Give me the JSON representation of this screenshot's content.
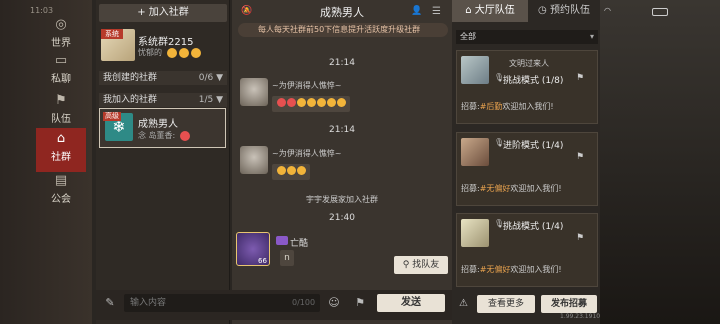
{
  "status_bar": {
    "clock": "11:03"
  },
  "nav": {
    "tabs": [
      {
        "label": "世界",
        "icon": "globe-icon",
        "active": false
      },
      {
        "label": "私聊",
        "icon": "chat-icon",
        "active": false
      },
      {
        "label": "队伍",
        "icon": "flag-icon",
        "active": false
      },
      {
        "label": "社群",
        "icon": "community-icon",
        "active": true
      },
      {
        "label": "公会",
        "icon": "guild-icon",
        "active": false
      }
    ]
  },
  "groups": {
    "join_label": "加入社群",
    "system": {
      "tag": "系统",
      "name": "系统群2215",
      "last_msg": "忧郁的"
    },
    "created": {
      "title": "我创建的社群",
      "count": "0/6"
    },
    "joined": {
      "title": "我加入的社群",
      "count": "1/5"
    },
    "selected": {
      "tag": "高级",
      "name": "成熟男人",
      "last_msg": "念 岛董香:"
    }
  },
  "chat": {
    "title": "成熟男人",
    "notice": "每人每天社群前50下信息提升活跃度升级社群",
    "messages": [
      {
        "time": "21:14",
        "name": "~为伊消得人憔悴~",
        "emoji_count": 7
      },
      {
        "time": "21:14",
        "name": "~为伊消得人憔悴~",
        "emoji_count": 3
      }
    ],
    "system_note": "宇宇发展家加入社群",
    "last_time": "21:40",
    "last_sender": {
      "name": "亡酷",
      "level": "66",
      "text": "n"
    },
    "find_team_label": "找队友",
    "input_placeholder": "输入内容",
    "input_counter": "0/100",
    "send_label": "发送"
  },
  "team": {
    "tab_active": "大厅队伍",
    "tab_other": "预约队伍",
    "filter": "全部",
    "cards": [
      {
        "name": "文明过来人",
        "mode": "挑战模式 (1/8)",
        "recruit_prefix": "招募:",
        "highlight": "#后勤",
        "recruit_suffix": "欢迎加入我们!"
      },
      {
        "name": "",
        "mode": "进阶模式 (1/4)",
        "recruit_prefix": "招募:",
        "highlight": "#无偏好",
        "recruit_suffix": "欢迎加入我们!"
      },
      {
        "name": "",
        "mode": "挑战模式 (1/4)",
        "recruit_prefix": "招募:",
        "highlight": "#无偏好",
        "recruit_suffix": "欢迎加入我们!"
      }
    ],
    "more_label": "查看更多",
    "post_label": "发布招募"
  },
  "footer": {
    "version": "1.99.23.1910"
  }
}
